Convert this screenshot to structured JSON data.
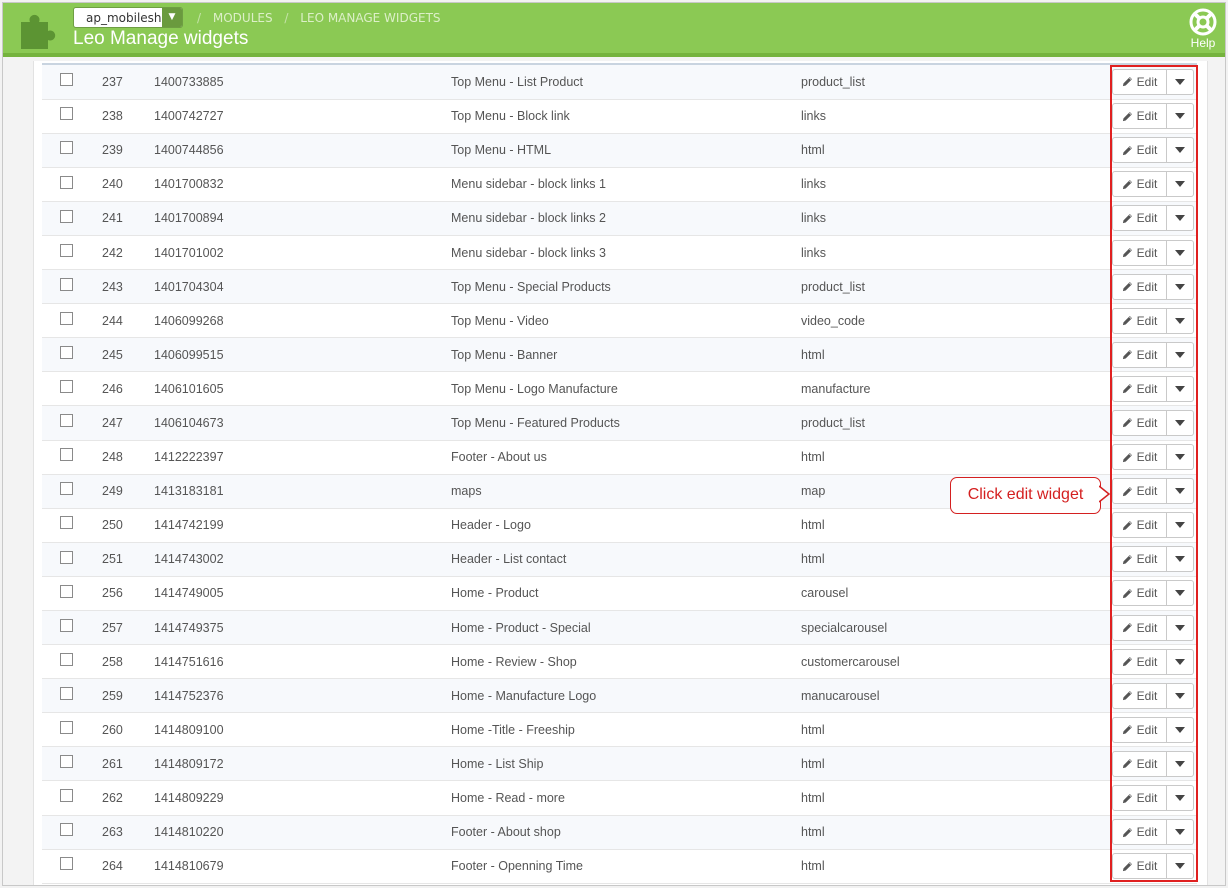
{
  "header": {
    "shop_select_value": "ap_mobileshop",
    "breadcrumb": [
      "MODULES",
      "LEO MANAGE WIDGETS"
    ],
    "breadcrumb_sep": "/",
    "page_title": "Leo Manage widgets",
    "help_label": "Help",
    "bar_color": "#8bc954"
  },
  "table": {
    "edit_label": "Edit",
    "rows": [
      {
        "id": "237",
        "key": "1400733885",
        "name": "Top Menu - List Product",
        "type": "product_list"
      },
      {
        "id": "238",
        "key": "1400742727",
        "name": "Top Menu - Block link",
        "type": "links"
      },
      {
        "id": "239",
        "key": "1400744856",
        "name": "Top Menu - HTML",
        "type": "html"
      },
      {
        "id": "240",
        "key": "1401700832",
        "name": "Menu sidebar - block links 1",
        "type": "links"
      },
      {
        "id": "241",
        "key": "1401700894",
        "name": "Menu sidebar - block links 2",
        "type": "links"
      },
      {
        "id": "242",
        "key": "1401701002",
        "name": "Menu sidebar - block links 3",
        "type": "links"
      },
      {
        "id": "243",
        "key": "1401704304",
        "name": "Top Menu - Special Products",
        "type": "product_list"
      },
      {
        "id": "244",
        "key": "1406099268",
        "name": "Top Menu - Video",
        "type": "video_code"
      },
      {
        "id": "245",
        "key": "1406099515",
        "name": "Top Menu - Banner",
        "type": "html"
      },
      {
        "id": "246",
        "key": "1406101605",
        "name": "Top Menu - Logo Manufacture",
        "type": "manufacture"
      },
      {
        "id": "247",
        "key": "1406104673",
        "name": "Top Menu - Featured Products",
        "type": "product_list"
      },
      {
        "id": "248",
        "key": "1412222397",
        "name": "Footer - About us",
        "type": "html"
      },
      {
        "id": "249",
        "key": "1413183181",
        "name": "maps",
        "type": "map"
      },
      {
        "id": "250",
        "key": "1414742199",
        "name": "Header - Logo",
        "type": "html"
      },
      {
        "id": "251",
        "key": "1414743002",
        "name": "Header - List contact",
        "type": "html"
      },
      {
        "id": "256",
        "key": "1414749005",
        "name": "Home - Product",
        "type": "carousel"
      },
      {
        "id": "257",
        "key": "1414749375",
        "name": "Home - Product - Special",
        "type": "specialcarousel"
      },
      {
        "id": "258",
        "key": "1414751616",
        "name": "Home - Review - Shop",
        "type": "customercarousel"
      },
      {
        "id": "259",
        "key": "1414752376",
        "name": "Home - Manufacture Logo",
        "type": "manucarousel"
      },
      {
        "id": "260",
        "key": "1414809100",
        "name": "Home -Title - Freeship",
        "type": "html"
      },
      {
        "id": "261",
        "key": "1414809172",
        "name": "Home - List Ship",
        "type": "html"
      },
      {
        "id": "262",
        "key": "1414809229",
        "name": "Home - Read - more",
        "type": "html"
      },
      {
        "id": "263",
        "key": "1414810220",
        "name": "Footer - About shop",
        "type": "html"
      },
      {
        "id": "264",
        "key": "1414810679",
        "name": "Footer - Openning Time",
        "type": "html"
      }
    ]
  },
  "annotation": {
    "callout_text": "Click edit widget",
    "color": "#e02020"
  }
}
